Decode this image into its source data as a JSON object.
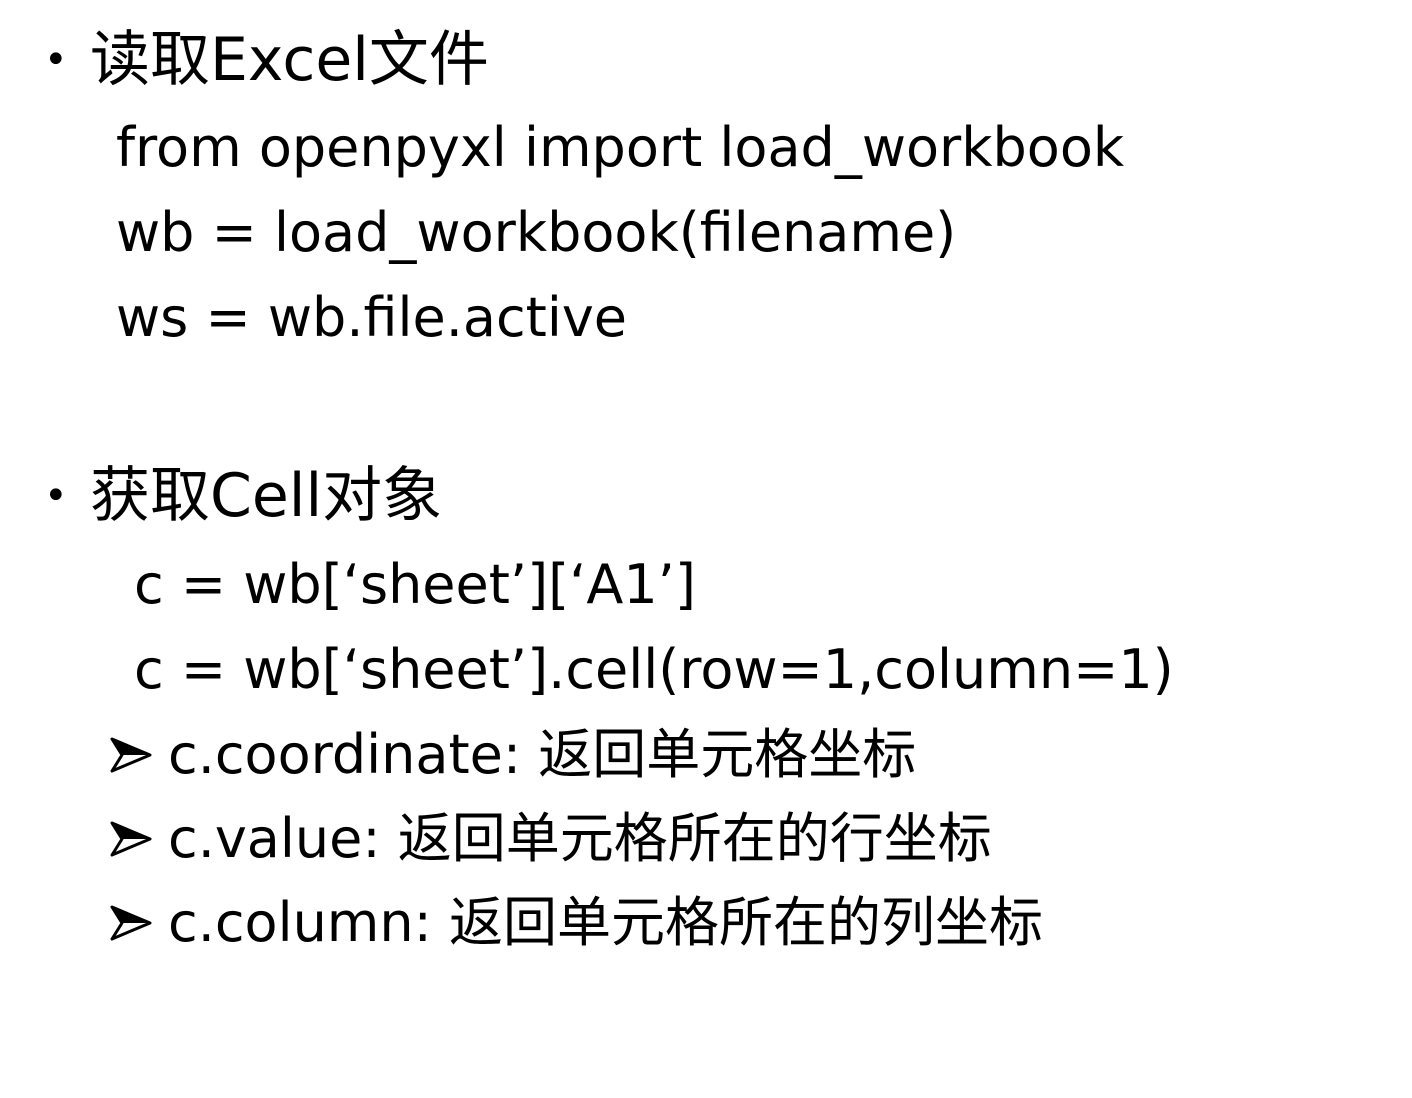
{
  "section1": {
    "bullet": "•",
    "heading": "读取Excel文件",
    "lines": [
      "from openpyxl import load_workbook",
      "wb = load_workbook(filename)",
      "ws = wb.file.active"
    ]
  },
  "section2": {
    "bullet": "•",
    "heading": "获取Cell对象",
    "lines": [
      "c = wb[‘sheet’][‘A1’]",
      "c = wb[‘sheet’].cell(row=1,column=1)"
    ],
    "sub_items": [
      "c.coordinate: 返回单元格坐标",
      "c.value: 返回单元格所在的行坐标",
      "c.column: 返回单元格所在的列坐标"
    ]
  },
  "icons": {
    "bullet": "bullet-dot-icon",
    "sub_bullet": "arrow-bullet-icon"
  }
}
